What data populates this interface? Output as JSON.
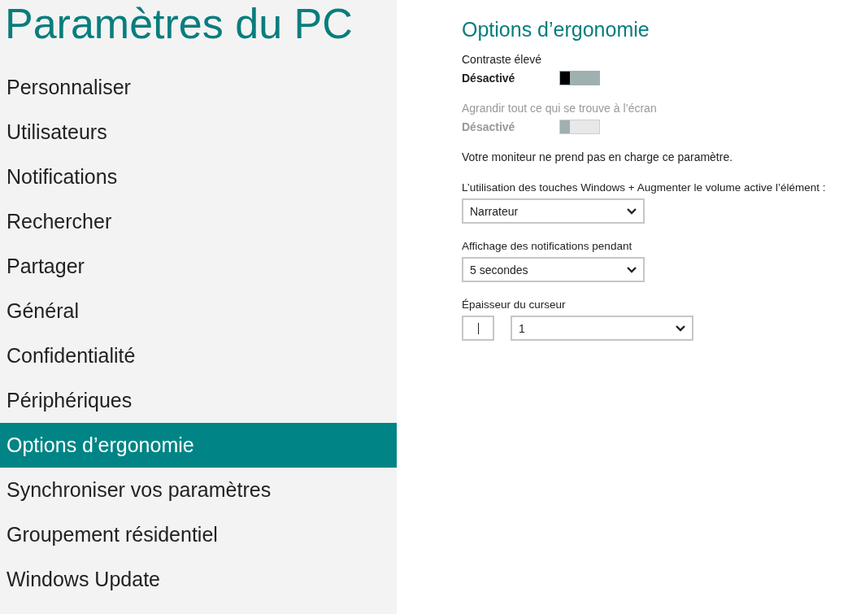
{
  "sidebar": {
    "title": "Paramètres du PC",
    "items": [
      {
        "label": "Personnaliser",
        "selected": false
      },
      {
        "label": "Utilisateurs",
        "selected": false
      },
      {
        "label": "Notifications",
        "selected": false
      },
      {
        "label": "Rechercher",
        "selected": false
      },
      {
        "label": "Partager",
        "selected": false
      },
      {
        "label": "Général",
        "selected": false
      },
      {
        "label": "Confidentialité",
        "selected": false
      },
      {
        "label": "Périphériques",
        "selected": false
      },
      {
        "label": "Options d’ergonomie",
        "selected": true
      },
      {
        "label": "Synchroniser vos paramètres",
        "selected": false
      },
      {
        "label": "Groupement résidentiel",
        "selected": false
      },
      {
        "label": "Windows Update",
        "selected": false
      }
    ]
  },
  "content": {
    "title": "Options d’ergonomie",
    "toggles": [
      {
        "label": "Contraste élevé",
        "state_text": "Désactivé",
        "on": false,
        "disabled": false
      },
      {
        "label": "Agrandir tout ce qui se trouve à l’écran",
        "state_text": "Désactivé",
        "on": false,
        "disabled": true
      }
    ],
    "note": "Votre moniteur ne prend pas en charge ce paramètre.",
    "dropdowns": [
      {
        "kind": "plain",
        "label": "L’utilisation des touches Windows + Augmenter le volume active l’élément :",
        "value": "Narrateur"
      },
      {
        "kind": "plain",
        "label": "Affichage des notifications pendant",
        "value": "5 secondes"
      },
      {
        "kind": "with_preview",
        "label": "Épaisseur du curseur",
        "value": "1"
      }
    ]
  }
}
